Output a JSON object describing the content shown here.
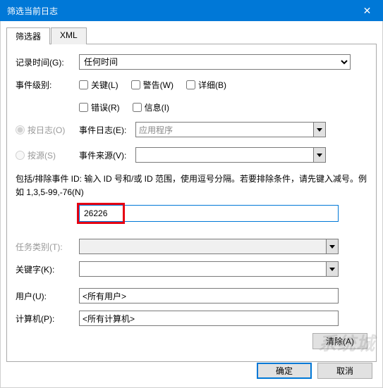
{
  "window": {
    "title": "筛选当前日志",
    "close_icon": "✕"
  },
  "tabs": {
    "filter": "筛选器",
    "xml": "XML"
  },
  "form": {
    "logged_time_label": "记录时间(G):",
    "logged_time_value": "任何时间",
    "event_level_label": "事件级别:",
    "levels": {
      "critical": "关键(L)",
      "warning": "警告(W)",
      "verbose": "详细(B)",
      "error": "错误(R)",
      "information": "信息(I)"
    },
    "by_log_label": "按日志(O)",
    "event_log_label": "事件日志(E):",
    "event_log_value": "应用程序",
    "by_source_label": "按源(S)",
    "event_source_label": "事件来源(V):",
    "help_text": "包括/排除事件 ID: 输入 ID 号和/或 ID 范围，使用逗号分隔。若要排除条件，请先键入减号。例如 1,3,5-99,-76(N)",
    "event_id_value": "26226",
    "task_category_label": "任务类别(T):",
    "keywords_label": "关键字(K):",
    "user_label": "用户(U):",
    "user_value": "<所有用户>",
    "computer_label": "计算机(P):",
    "computer_value": "<所有计算机>",
    "clear_btn": "清除(A)"
  },
  "footer": {
    "ok": "确定",
    "cancel": "取消"
  },
  "watermark": "系统城"
}
